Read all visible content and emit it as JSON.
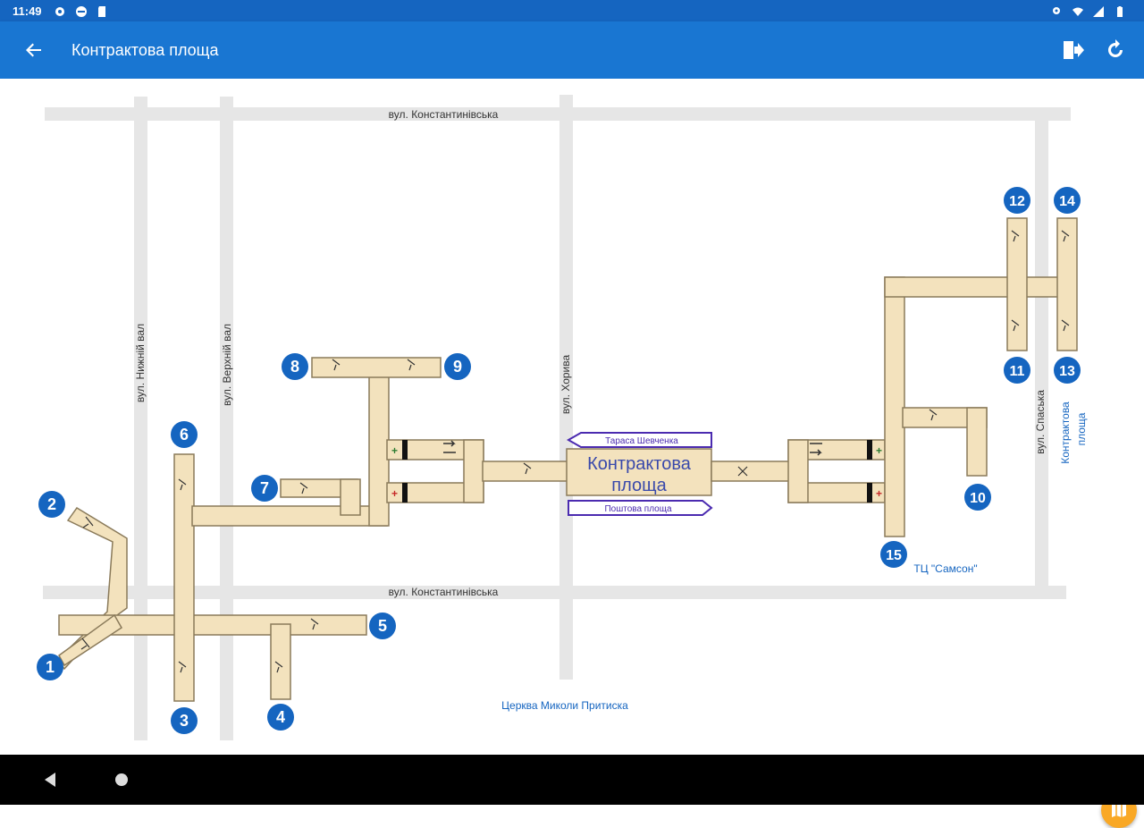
{
  "status_bar": {
    "time": "11:49"
  },
  "app_bar": {
    "title": "Контрактова площа"
  },
  "map": {
    "streets": {
      "konstantynivska_top": "вул. Константинівська",
      "konstantynivska_bottom": "вул. Константинівська",
      "nyzhnii_val": "вул. Нижній вал",
      "verkhnii_val": "вул. Верхній вал",
      "khoryva": "вул. Хорива",
      "spaska": "вул. Спаська"
    },
    "station": {
      "name_line1": "Контрактова",
      "name_line2": "площа",
      "direction_up": "Тараса Шевченка",
      "direction_down": "Поштова площа"
    },
    "landmarks": {
      "tc_samson": "ТЦ \"Самсон\"",
      "kontraktova_side_line1": "Контрактова",
      "kontraktova_side_line2": "площа",
      "church": "Церква Миколи Притиска"
    },
    "exits": [
      "1",
      "2",
      "3",
      "4",
      "5",
      "6",
      "7",
      "8",
      "9",
      "10",
      "11",
      "12",
      "13",
      "14",
      "15"
    ],
    "colors": {
      "tunnel": "#f3e2bd",
      "street": "#e6e6e6",
      "exit_badge": "#1565c0",
      "accent": "#1976d2",
      "direction_sign": "#4b2bb0"
    }
  }
}
